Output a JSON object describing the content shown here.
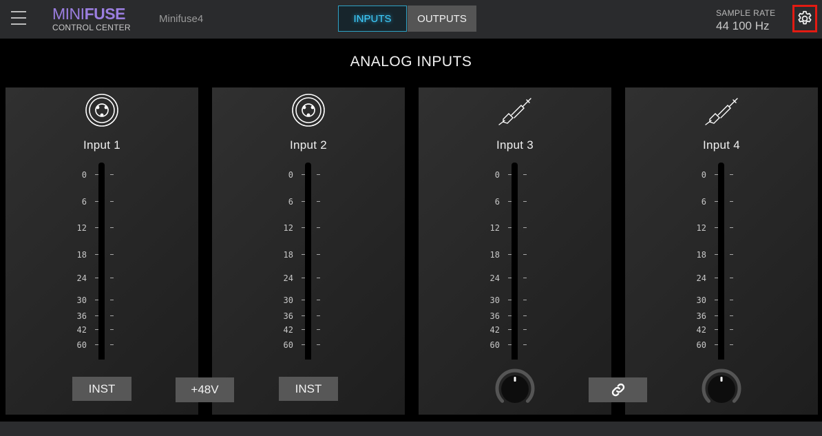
{
  "header": {
    "menu_icon": "hamburger-menu-icon",
    "logo": {
      "part1": "MINI",
      "part2": "FUSE",
      "subtitle": "CONTROL CENTER"
    },
    "device_name": "Minifuse4",
    "tabs": [
      {
        "label": "INPUTS",
        "active": true
      },
      {
        "label": "OUTPUTS",
        "active": false
      }
    ],
    "sample_rate": {
      "label": "SAMPLE RATE",
      "value": "44 100 Hz"
    },
    "settings_icon": "gear-icon"
  },
  "section_title": "ANALOG INPUTS",
  "meter_scale": [
    "0",
    "6",
    "12",
    "18",
    "24",
    "30",
    "36",
    "42",
    "60"
  ],
  "channels": [
    {
      "name": "Input 1",
      "icon": "xlr-combo-jack-icon",
      "control_label": "INST"
    },
    {
      "name": "Input 2",
      "icon": "xlr-combo-jack-icon",
      "control_label": "INST"
    },
    {
      "name": "Input 3",
      "icon": "jack-cable-icon",
      "control": "gain-knob"
    },
    {
      "name": "Input 4",
      "icon": "jack-cable-icon",
      "control": "gain-knob"
    }
  ],
  "phantom_button": "+48V",
  "link_icon": "link-icon",
  "colors": {
    "accent": "#3fcfff",
    "logo": "#9b7ee0",
    "highlight_box": "#e31b12"
  }
}
